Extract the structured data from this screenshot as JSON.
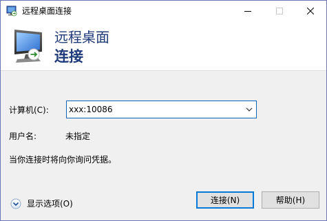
{
  "window": {
    "title": "远程桌面连接",
    "app_icon": "remote-desktop-icon"
  },
  "titlebar_buttons": {
    "minimize_icon": "minimize-icon",
    "maximize_icon": "maximize-icon",
    "close_icon": "close-icon"
  },
  "banner": {
    "line1": "远程桌面",
    "line2": "连接",
    "icon": "remote-desktop-monitor-icon",
    "text_color": "#1e3a7a"
  },
  "form": {
    "computer_label": "计算机(C):",
    "computer_value": "xxx:10086",
    "user_label": "用户名:",
    "user_value": "未指定",
    "note": "当你连接时将向你询问凭据。"
  },
  "footer": {
    "options_label": "显示选项(O)",
    "options_icon": "chevron-down-circle-icon",
    "connect_label": "连接(N)",
    "help_label": "帮助(H)"
  },
  "colors": {
    "accent": "#0078d7",
    "window_border": "#6b74b8",
    "background": "#f0f0f0"
  }
}
